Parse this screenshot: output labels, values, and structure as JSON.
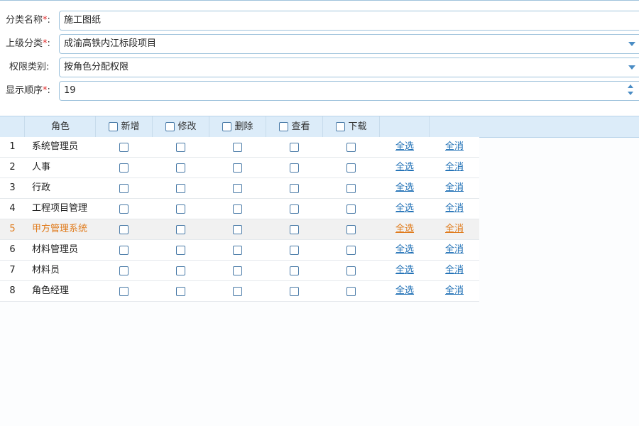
{
  "form": {
    "category_name": {
      "label": "分类名称",
      "req": "*",
      "colon": ":",
      "value": "施工图纸"
    },
    "parent_category": {
      "label": "上级分类",
      "req": "*",
      "colon": ":",
      "value": "成渝高铁内江标段项目"
    },
    "permission_type": {
      "label": "权限类别:",
      "value": "按角色分配权限"
    },
    "display_order": {
      "label": "显示顺序",
      "req": "*",
      "colon": ":",
      "value": "19"
    }
  },
  "table": {
    "headers": {
      "role": "角色",
      "add": "新增",
      "edit": "修改",
      "delete": "删除",
      "view": "查看",
      "download": "下载"
    },
    "select_all_label": "全选",
    "deselect_all_label": "全消",
    "rows": [
      {
        "num": "1",
        "role": "系统管理员"
      },
      {
        "num": "2",
        "role": "人事"
      },
      {
        "num": "3",
        "role": "行政"
      },
      {
        "num": "4",
        "role": "工程项目管理"
      },
      {
        "num": "5",
        "role": "甲方管理系统"
      },
      {
        "num": "6",
        "role": "材料管理员"
      },
      {
        "num": "7",
        "role": "材料员"
      },
      {
        "num": "8",
        "role": "角色经理"
      }
    ]
  },
  "colors": {
    "header_bg": "#dcecf9",
    "input_border": "#9fc3dc",
    "link": "#1e6fb5",
    "highlight_text": "#e07b1c",
    "required": "#e02b2b"
  }
}
